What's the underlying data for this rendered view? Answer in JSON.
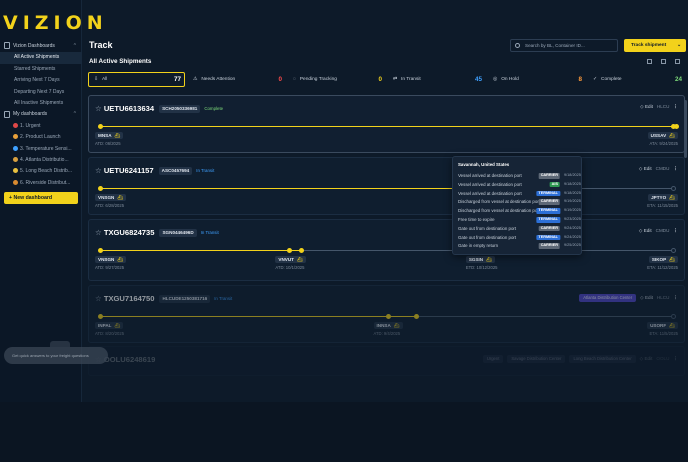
{
  "app": {
    "logo": "VIZION"
  },
  "sidebar": {
    "groups": [
      {
        "label": "Vizion Dashboards"
      },
      {
        "label": "My dashboards"
      }
    ],
    "vizion_items": [
      {
        "label": "All Active Shipments",
        "active": true
      },
      {
        "label": "Starred Shipments"
      },
      {
        "label": "Arriving Next 7 Days"
      },
      {
        "label": "Departing Next 7 Days"
      },
      {
        "label": "All Inactive Shipments"
      }
    ],
    "my_items": [
      {
        "label": "1. Urgent",
        "dot": "#e04848"
      },
      {
        "label": "2. Product Launch",
        "dot": "#e8a03a"
      },
      {
        "label": "3. Temperature Sensi...",
        "dot": "#3ea0ff"
      },
      {
        "label": "4. Atlanta Distributio...",
        "dot": "#d8a040"
      },
      {
        "label": "5. Long Beach Distrib...",
        "dot": "#e8c040"
      },
      {
        "label": "6. Riverside Distribut...",
        "dot": "#d88a30"
      }
    ],
    "new_dashboard": "+ New dashboard",
    "toast": "Get quick answers to your freight questions"
  },
  "header": {
    "title": "Track",
    "subtitle": "All Active Shipments",
    "search_placeholder": "Search by BL, Container ID...",
    "track_button": "Track shipment",
    "track_chevron": "⌄"
  },
  "filters": [
    {
      "icon": "⇩",
      "label": "All",
      "count": "77",
      "color": "#ffffff",
      "selected": true
    },
    {
      "icon": "⚠",
      "label": "Needs Attention",
      "count": "0",
      "color": "#ff4a4a"
    },
    {
      "icon": "◌",
      "label": "Pending Tracking",
      "count": "0",
      "color": "#f2d21b"
    },
    {
      "icon": "⇄",
      "label": "In Transit",
      "count": "45",
      "color": "#3ea0ff"
    },
    {
      "icon": "◎",
      "label": "On Hold",
      "count": "8",
      "color": "#ff9a3a"
    },
    {
      "icon": "✓",
      "label": "Complete",
      "count": "24",
      "color": "#7ddc7a"
    }
  ],
  "shipments": [
    {
      "id": "UETU6613634",
      "bl": "SCH2050336981",
      "status": "Complete",
      "status_kind": "complete",
      "edit": "Edit",
      "scac": "HLCU",
      "origin": "MNSA",
      "origin_date": "ATD: 06/2025",
      "dest": "USSAV",
      "dest_date": "ATA: 9/24/2025",
      "progress": 100
    },
    {
      "id": "UETU6241157",
      "bl": "ASC0457694",
      "status": "In Transit",
      "status_kind": "transit",
      "edit": "Edit",
      "scac": "CMDU",
      "origin": "VNSGN",
      "origin_date": "ATD: 6/28/2025",
      "dest": "JPTYO",
      "dest_date": "ETA: 11/15/2025",
      "progress": 70
    },
    {
      "id": "TXGU6824735",
      "bl": "SGN0446496D",
      "status": "In Transit",
      "status_kind": "transit",
      "edit": "Edit",
      "scac": "CMDU",
      "origin": "VNSGN",
      "origin_date": "ATD: 9/27/2025",
      "mid1": "VNVUT",
      "mid1_date": "ATD: 10/1/2025",
      "mid2": "SGSIN",
      "mid2_date": "ETD: 10/12/2025",
      "dest": "SIKOP",
      "dest_date": "ETA: 11/12/2025",
      "progress": 35
    },
    {
      "id": "TXGU7164750",
      "bl": "HLCUDE1250381716",
      "status": "In Transit",
      "status_kind": "transit",
      "tag": "Atlanta Distribution Center",
      "edit": "Edit",
      "scac": "HLCU",
      "origin": "INPAL",
      "origin_date": "ATD: 8/20/2025",
      "mid1": "INNSA",
      "mid1_date": "ATD: 9/4/2025",
      "dest": "USORF",
      "dest_date": "ETA: 11/5/2025",
      "progress": 55
    },
    {
      "id": "OOLU6248619",
      "bl": "",
      "status": "",
      "status_kind": "transit",
      "tags": [
        "Urgent",
        "Savage Distribution Center",
        "Long Beach Distribution Center"
      ],
      "edit": "Edit",
      "scac": "OOLU"
    }
  ],
  "popover": {
    "title": "Savannah, United States",
    "events": [
      {
        "event": "Vessel arrived at destination port",
        "source": "CARRIER",
        "kind": "carrier",
        "date": "9/18/2025"
      },
      {
        "event": "Vessel arrived at destination port",
        "source": "AIS",
        "kind": "ais",
        "date": "9/18/2025"
      },
      {
        "event": "Vessel arrived at destination port",
        "source": "TERMINAL",
        "kind": "terminal",
        "date": "9/18/2025"
      },
      {
        "event": "Discharged from vessel at destination port",
        "source": "CARRIER",
        "kind": "carrier",
        "date": "9/19/2025"
      },
      {
        "event": "Discharged from vessel at destination port",
        "source": "TERMINAL",
        "kind": "terminal",
        "date": "9/19/2025"
      },
      {
        "event": "Free time to expire",
        "source": "TERMINAL",
        "kind": "terminal",
        "date": "9/23/2025"
      },
      {
        "event": "Gate out from destination port",
        "source": "CARRIER",
        "kind": "carrier",
        "date": "9/24/2025"
      },
      {
        "event": "Gate out from destination port",
        "source": "TERMINAL",
        "kind": "terminal",
        "date": "9/24/2025"
      },
      {
        "event": "Gate in empty return",
        "source": "CARRIER",
        "kind": "carrier",
        "date": "9/25/2025"
      }
    ]
  },
  "colors": {
    "accent": "#f2d21b",
    "bg": "#0d1a29",
    "transit": "#3ea0ff",
    "complete": "#7ddc7a"
  }
}
